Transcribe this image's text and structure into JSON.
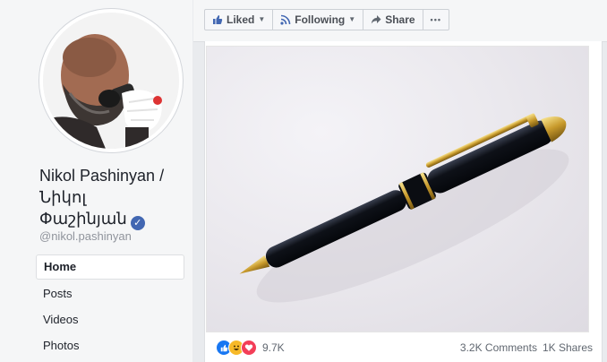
{
  "profile": {
    "name_line1": "Nikol Pashinyan /",
    "name_line2": "Նիկոլ",
    "name_line3": "Փաշինյան",
    "handle": "@nikol.pashinyan"
  },
  "nav": {
    "items": [
      {
        "label": "Home",
        "active": true
      },
      {
        "label": "Posts"
      },
      {
        "label": "Videos"
      },
      {
        "label": "Photos"
      }
    ]
  },
  "toolbar": {
    "liked_label": "Liked",
    "following_label": "Following",
    "share_label": "Share",
    "more_label": "•••"
  },
  "post": {
    "reaction_count": "9.7K",
    "comments": "3.2K Comments",
    "shares": "1K Shares"
  },
  "colors": {
    "fb_blue": "#4267b2",
    "like": "#1877f2",
    "haha": "#f7b928",
    "love": "#f33e58"
  }
}
